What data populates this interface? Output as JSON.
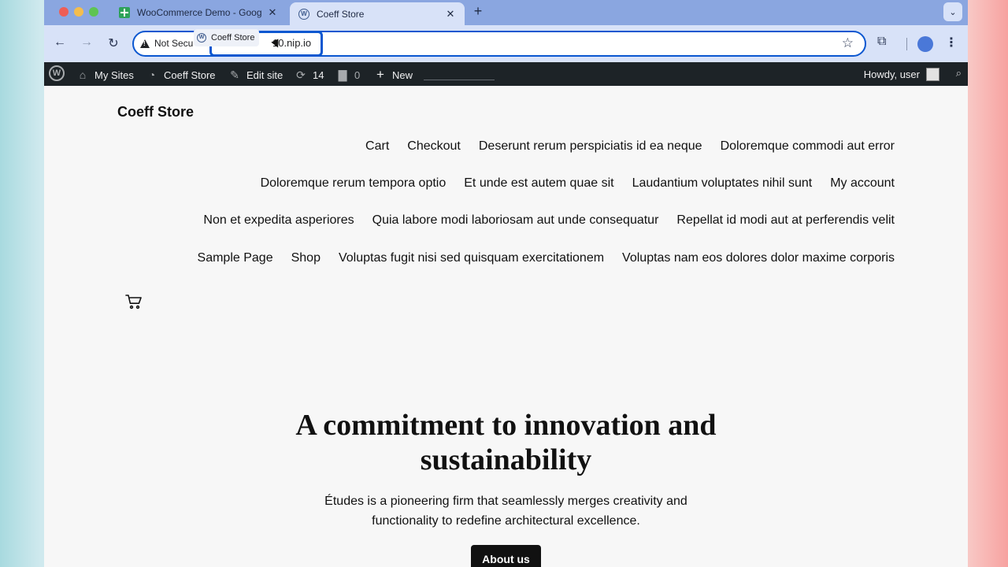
{
  "browser": {
    "tabs": [
      {
        "title": "WooCommerce Demo - Goog",
        "icon": "sheets-icon",
        "active": false
      },
      {
        "title": "Coeff Store",
        "icon": "wordpress-icon",
        "active": true
      }
    ],
    "close_glyph": "✕",
    "new_tab_glyph": "+",
    "tab_menu_glyph": "⌄",
    "address": {
      "security_label": "Not Secu",
      "url_visible": "10.nip.io",
      "dragged_tab_label": "Coeff Store"
    },
    "accent_color": "#0b57d0"
  },
  "admin_bar": {
    "my_sites": "My Sites",
    "site_name": "Coeff Store",
    "edit_site": "Edit site",
    "updates_count": "14",
    "comments_count": "0",
    "new_label": "New",
    "howdy": "Howdy, user"
  },
  "site": {
    "title": "Coeff Store",
    "nav_rows": [
      [
        "Cart",
        "Checkout",
        "Deserunt rerum perspiciatis id ea neque",
        "Doloremque commodi aut error"
      ],
      [
        "Doloremque rerum tempora optio",
        "Et unde est autem quae sit",
        "Laudantium voluptates nihil sunt",
        "My account"
      ],
      [
        "Non et expedita asperiores",
        "Quia labore modi laboriosam aut unde consequatur",
        "Repellat id modi aut at perferendis velit"
      ],
      [
        "Sample Page",
        "Shop",
        "Voluptas fugit nisi sed quisquam exercitationem",
        "Voluptas nam eos dolores dolor maxime corporis"
      ]
    ],
    "hero": {
      "title_lines": [
        "A commitment to innovation and",
        "sustainability"
      ],
      "subtitle_lines": [
        "Études is a pioneering firm that seamlessly merges creativity and",
        "functionality to redefine architectural excellence."
      ],
      "cta": "About us"
    }
  }
}
